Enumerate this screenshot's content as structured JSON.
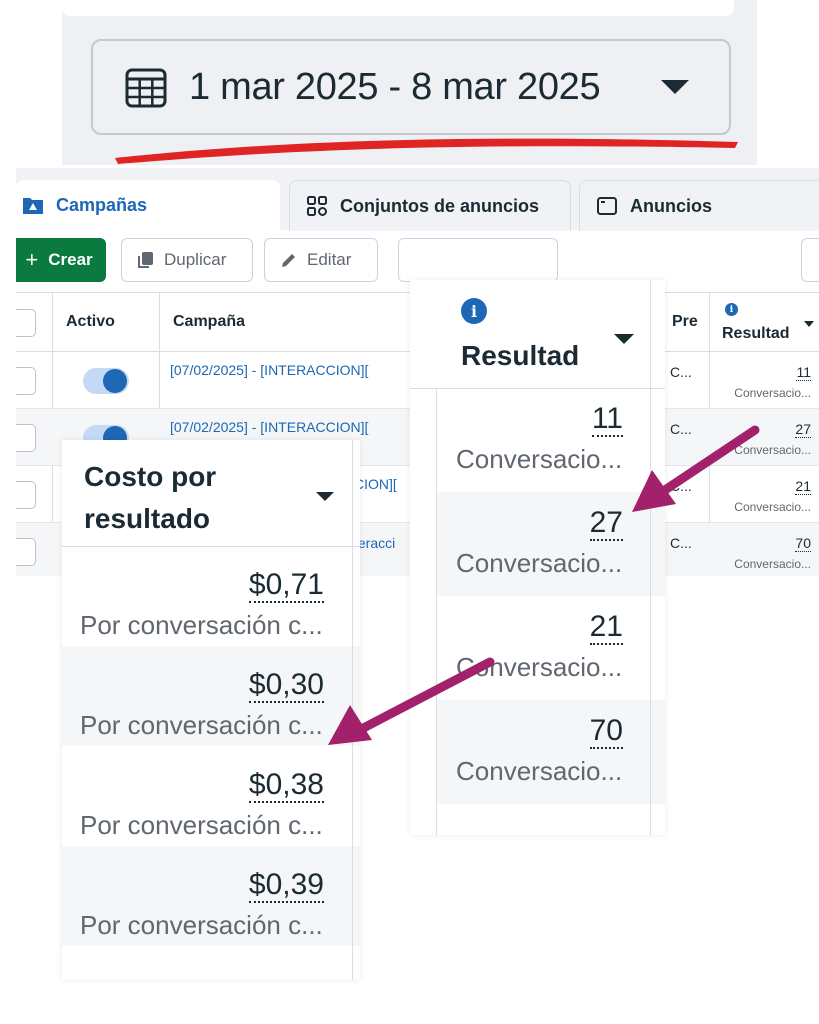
{
  "date_range": {
    "label": "1 mar 2025 - 8 mar 2025"
  },
  "tabs": [
    {
      "label": "Campañas",
      "icon": "folder-icon",
      "active": true
    },
    {
      "label": "Conjuntos de anuncios",
      "icon": "grid-icon",
      "active": false
    },
    {
      "label": "Anuncios",
      "icon": "window-icon",
      "active": false
    }
  ],
  "toolbar": {
    "create_label": "Crear",
    "duplicate_label": "Duplicar",
    "edit_label": "Editar"
  },
  "table": {
    "headers": {
      "active": "Activo",
      "campaign": "Campaña",
      "pre": "Pre",
      "result": "Resultad"
    },
    "rows": [
      {
        "campaign": "[07/02/2025] - [INTERACCION][",
        "pre": "C...",
        "result": "11",
        "result_sub": "Conversacio..."
      },
      {
        "campaign": "[07/02/2025] - [INTERACCION][",
        "pre": "C...",
        "result": "27",
        "result_sub": "Conversacio..."
      },
      {
        "campaign": "CION][",
        "pre": "C...",
        "result": "21",
        "result_sub": "Conversacio..."
      },
      {
        "campaign": "teracci",
        "pre": "C...",
        "result": "70",
        "result_sub": "Conversacio..."
      }
    ]
  },
  "zoom_result": {
    "title": "Resultad",
    "rows": [
      {
        "value": "11",
        "sub": "Conversacio..."
      },
      {
        "value": "27",
        "sub": "Conversacio..."
      },
      {
        "value": "21",
        "sub": "Conversacio..."
      },
      {
        "value": "70",
        "sub": "Conversacio..."
      }
    ]
  },
  "zoom_cost": {
    "title_line1": "Costo por",
    "title_line2": "resultado",
    "rows": [
      {
        "value": "$0,71",
        "sub": "Por conversación c..."
      },
      {
        "value": "$0,30",
        "sub": "Por conversación c..."
      },
      {
        "value": "$0,38",
        "sub": "Por conversación c..."
      },
      {
        "value": "$0,39",
        "sub": "Por conversación c..."
      }
    ]
  },
  "colors": {
    "accent": "#1d67b5",
    "create_green": "#0a7a3e",
    "annotation_red": "#e02424",
    "arrow_magenta": "#a3206b"
  }
}
